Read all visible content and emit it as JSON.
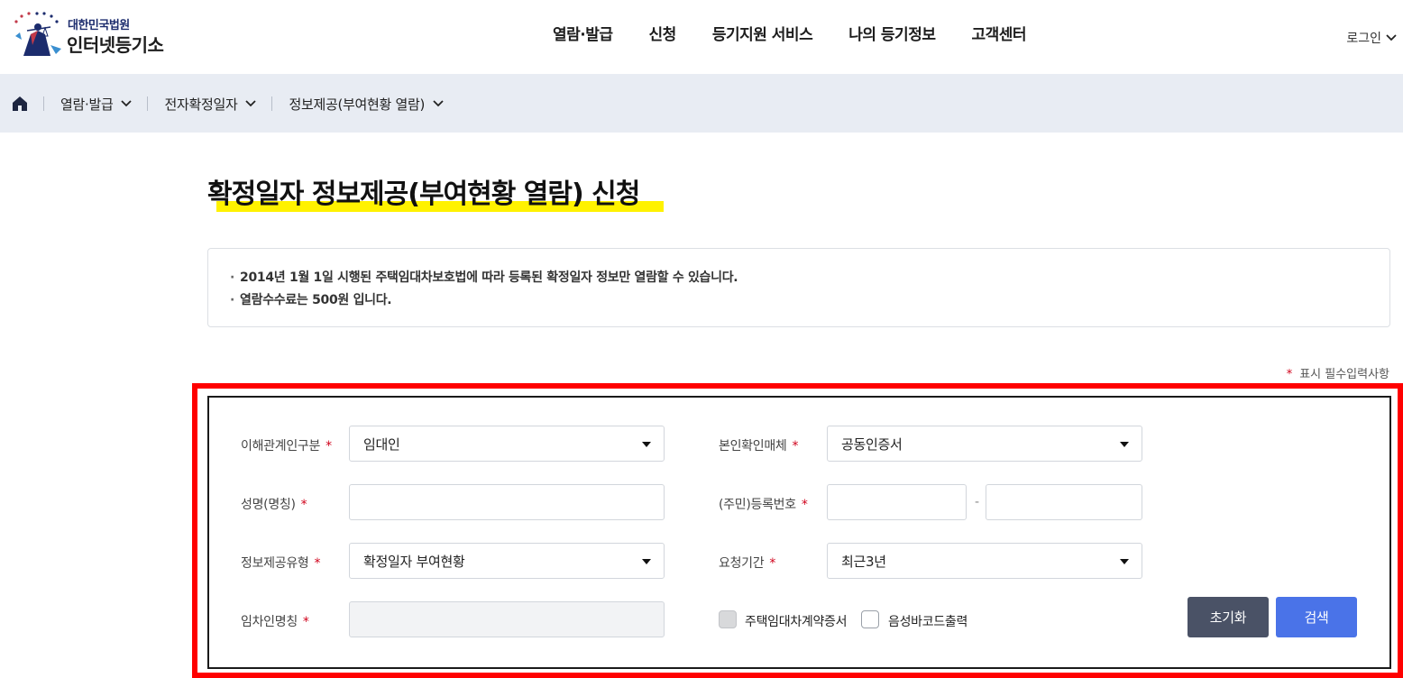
{
  "header": {
    "logo_sub": "대한민국법원",
    "logo_main": "인터넷등기소",
    "nav": [
      "열람·발급",
      "신청",
      "등기지원 서비스",
      "나의 등기정보",
      "고객센터"
    ],
    "login_label": "로그인"
  },
  "breadcrumb": {
    "items": [
      "열람·발급",
      "전자확정일자",
      "정보제공(부여현황 열람)"
    ]
  },
  "page": {
    "title": "확정일자 정보제공(부여현황 열람) 신청",
    "notices": [
      "2014년 1월 1일 시행된 주택임대차보호법에 따라 등록된 확정일자 정보만 열람할 수 있습니다.",
      "열람수수료는 500원 입니다."
    ],
    "required_note_star": "*",
    "required_note": "표시 필수입력사항"
  },
  "form": {
    "required_mark": "*",
    "party_type": {
      "label": "이해관계인구분",
      "value": "임대인"
    },
    "id_medium": {
      "label": "본인확인매체",
      "value": "공동인증서"
    },
    "name": {
      "label": "성명(명칭)",
      "value": ""
    },
    "reg_no": {
      "label": "(주민)등록번호",
      "value1": "",
      "value2": "",
      "separator": "-"
    },
    "info_type": {
      "label": "정보제공유형",
      "value": "확정일자 부여현황"
    },
    "period": {
      "label": "요청기간",
      "value": "최근3년"
    },
    "tenant_name": {
      "label": "임차인명칭",
      "value": ""
    },
    "checkbox_contract": {
      "label": "주택임대차계약증서",
      "checked": false,
      "disabled": true
    },
    "checkbox_barcode": {
      "label": "음성바코드출력",
      "checked": false
    },
    "reset_label": "초기화",
    "search_label": "검색"
  },
  "colors": {
    "highlight_frame": "#ff0000",
    "title_underline": "#fff200",
    "search_button": "#4a73e8",
    "reset_button": "#4a5266",
    "required": "#d0021b"
  }
}
